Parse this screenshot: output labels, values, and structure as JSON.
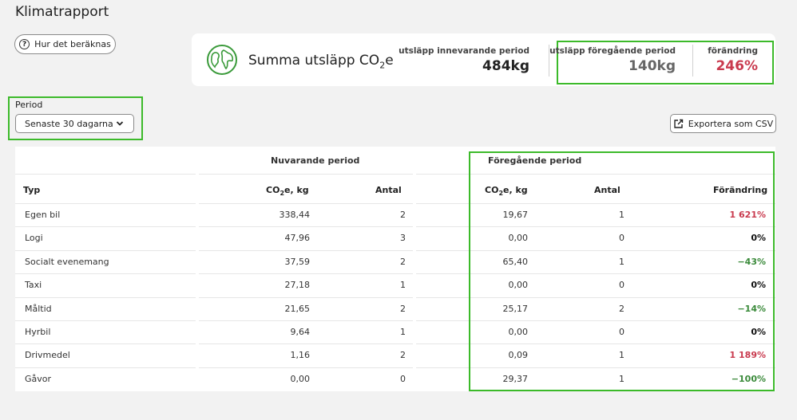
{
  "page": {
    "title": "Klimatrapport"
  },
  "buttons": {
    "how": "Hur det beräknas",
    "export": "Exportera som CSV"
  },
  "summary": {
    "title": "Summa utsläpp CO",
    "title_sub": "2",
    "title_suffix": "e",
    "current": {
      "label": "utsläpp innevarande period",
      "value": "484kg"
    },
    "previous": {
      "label": "utsläpp föregående period",
      "value": "140kg"
    },
    "change": {
      "label": "förändring",
      "value": "246%"
    }
  },
  "period": {
    "label": "Period",
    "selected": "Senaste 30 dagarna"
  },
  "table": {
    "group_current": "Nuvarande period",
    "group_previous": "Föregående period",
    "headers": {
      "type": "Typ",
      "co2_prefix": "CO",
      "co2_sub": "2",
      "co2_suffix": "e, kg",
      "count": "Antal",
      "change": "Förändring"
    },
    "rows": [
      {
        "type": "Egen bil",
        "cur_co2": "338,44",
        "cur_count": "2",
        "prev_co2": "19,67",
        "prev_count": "1",
        "change": "1 621%",
        "trend": "pos"
      },
      {
        "type": "Logi",
        "cur_co2": "47,96",
        "cur_count": "3",
        "prev_co2": "0,00",
        "prev_count": "0",
        "change": "0%",
        "trend": "zero"
      },
      {
        "type": "Socialt evenemang",
        "cur_co2": "37,59",
        "cur_count": "2",
        "prev_co2": "65,40",
        "prev_count": "1",
        "change": "−43%",
        "trend": "neg"
      },
      {
        "type": "Taxi",
        "cur_co2": "27,18",
        "cur_count": "1",
        "prev_co2": "0,00",
        "prev_count": "0",
        "change": "0%",
        "trend": "zero"
      },
      {
        "type": "Måltid",
        "cur_co2": "21,65",
        "cur_count": "2",
        "prev_co2": "25,17",
        "prev_count": "2",
        "change": "−14%",
        "trend": "neg"
      },
      {
        "type": "Hyrbil",
        "cur_co2": "9,64",
        "cur_count": "1",
        "prev_co2": "0,00",
        "prev_count": "0",
        "change": "0%",
        "trend": "zero"
      },
      {
        "type": "Drivmedel",
        "cur_co2": "1,16",
        "cur_count": "2",
        "prev_co2": "0,09",
        "prev_count": "1",
        "change": "1 189%",
        "trend": "pos"
      },
      {
        "type": "Gåvor",
        "cur_co2": "0,00",
        "cur_count": "0",
        "prev_co2": "29,37",
        "prev_count": "1",
        "change": "−100%",
        "trend": "neg"
      }
    ]
  },
  "colors": {
    "highlight": "#3cba2a",
    "positive_change": "#c93a4e",
    "negative_change": "#3a8a3a"
  }
}
